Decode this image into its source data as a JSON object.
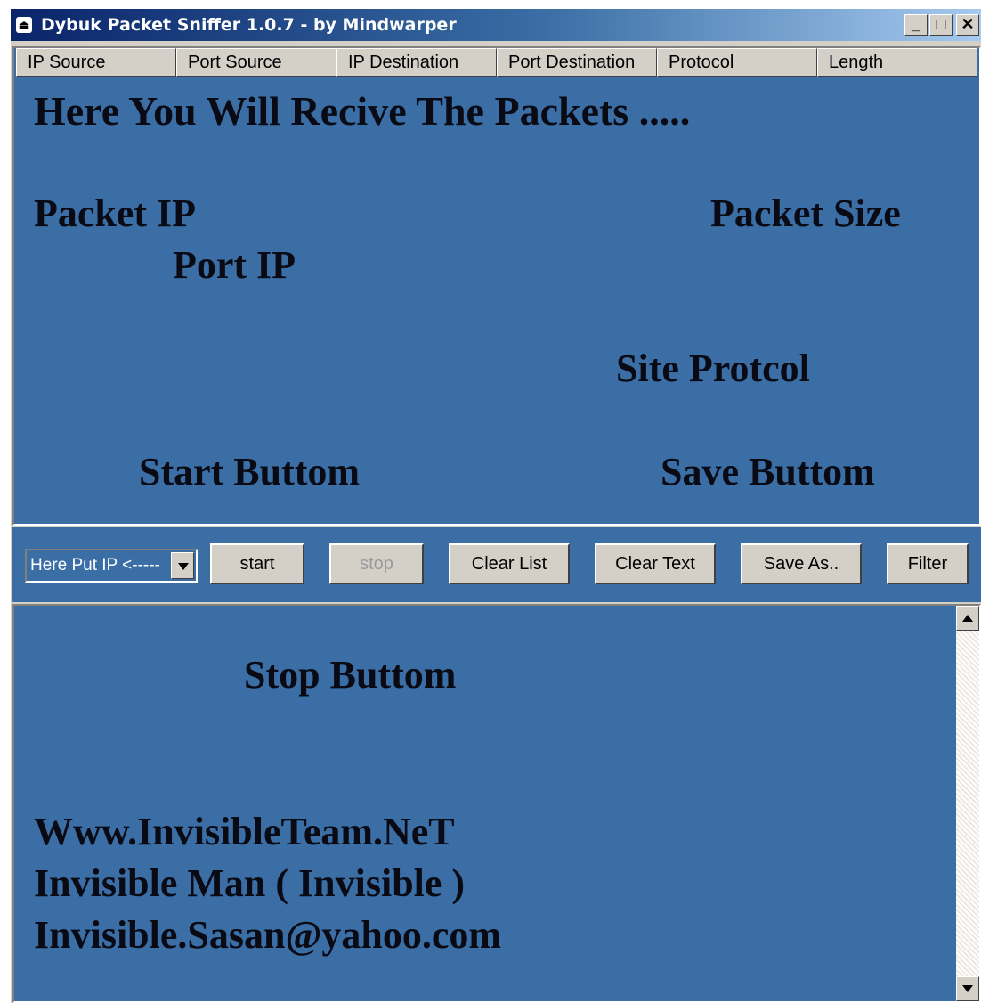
{
  "window": {
    "title": "Dybuk Packet Sniffer 1.0.7 - by Mindwarper",
    "minimize": "_",
    "maximize": "□",
    "close": "✕"
  },
  "list": {
    "columns": [
      "IP Source",
      "Port Source",
      "IP Destination",
      "Port Destination",
      "Protocol",
      "Length"
    ],
    "annotations": {
      "heading": "Here You Will Recive The Packets  .....",
      "packet_ip": "Packet IP",
      "packet_size": "Packet Size",
      "port_ip": "Port IP",
      "site_protocol": "Site Protcol",
      "start_button": "Start Buttom",
      "save_button": "Save Buttom"
    }
  },
  "controls": {
    "ip_combo_value": "Here Put IP <-----",
    "start": "start",
    "stop": "stop",
    "clear_list": "Clear List",
    "clear_text": "Clear Text",
    "save_as": "Save As..",
    "filter": "Filter"
  },
  "text_area": {
    "stop_button": "Stop Buttom",
    "credits": [
      "Www.InvisibleTeam.NeT",
      "Invisible Man ( Invisible )",
      "Invisible.Sasan@yahoo.com"
    ]
  },
  "colors": {
    "panel_bg": "#3a6ea5",
    "title_start": "#0a246a",
    "face": "#d4d0c8"
  }
}
